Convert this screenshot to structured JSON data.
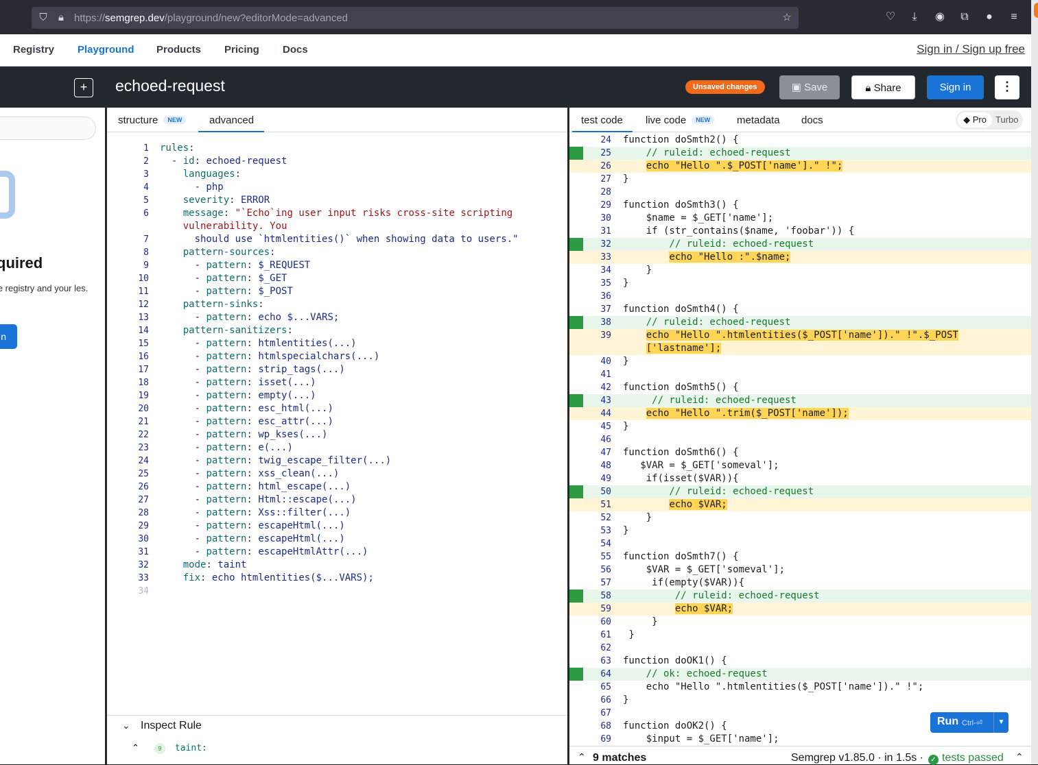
{
  "browser": {
    "url_prefix": "https://",
    "url_host": "semgrep.dev",
    "url_path": "/playground/new?editorMode=advanced"
  },
  "nav": {
    "links": [
      "Registry",
      "Playground",
      "Products",
      "Pricing",
      "Docs"
    ],
    "active": "Playground",
    "signup": "Sign in / Sign up free"
  },
  "sidebar": {
    "title_partial": "quired",
    "desc_partial": "the registry and your les.",
    "button_partial": "n"
  },
  "header": {
    "rule_name": "echoed-request",
    "unsaved_badge": "Unsaved changes",
    "save": "Save",
    "share": "Share",
    "signin": "Sign in",
    "more": "⋮"
  },
  "left_tabs": {
    "structure": "structure",
    "structure_badge": "NEW",
    "advanced": "advanced"
  },
  "right_tabs": {
    "test_code": "test code",
    "live_code": "live code",
    "live_badge": "NEW",
    "metadata": "metadata",
    "docs": "docs",
    "pro": "Pro",
    "turbo": "Turbo"
  },
  "inspect": {
    "title": "Inspect Rule",
    "badge": "9",
    "item": "taint:"
  },
  "run": {
    "label": "Run",
    "shortcut": "Ctrl-⏎"
  },
  "status": {
    "matches": "9 matches",
    "version": "Semgrep v1.85.0 · in 1.5s ·",
    "tests": "tests passed"
  },
  "yaml_lines": [
    {
      "n": "1",
      "t": "rules:"
    },
    {
      "n": "2",
      "t": "  - id: echoed-request"
    },
    {
      "n": "3",
      "t": "    languages:"
    },
    {
      "n": "4",
      "t": "      - php"
    },
    {
      "n": "5",
      "t": "    severity: ERROR"
    },
    {
      "n": "6",
      "t": "    message: \"`Echo`ing user input risks cross-site scripting"
    },
    {
      "n": "",
      "t": "    vulnerability. You"
    },
    {
      "n": "7",
      "t": "      should use `htmlentities()` when showing data to users.\""
    },
    {
      "n": "8",
      "t": "    pattern-sources:"
    },
    {
      "n": "9",
      "t": "      - pattern: $_REQUEST"
    },
    {
      "n": "10",
      "t": "      - pattern: $_GET"
    },
    {
      "n": "11",
      "t": "      - pattern: $_POST"
    },
    {
      "n": "12",
      "t": "    pattern-sinks:"
    },
    {
      "n": "13",
      "t": "      - pattern: echo $...VARS;"
    },
    {
      "n": "14",
      "t": "    pattern-sanitizers:"
    },
    {
      "n": "15",
      "t": "      - pattern: htmlentities(...)"
    },
    {
      "n": "16",
      "t": "      - pattern: htmlspecialchars(...)"
    },
    {
      "n": "17",
      "t": "      - pattern: strip_tags(...)"
    },
    {
      "n": "18",
      "t": "      - pattern: isset(...)"
    },
    {
      "n": "19",
      "t": "      - pattern: empty(...)"
    },
    {
      "n": "20",
      "t": "      - pattern: esc_html(...)"
    },
    {
      "n": "21",
      "t": "      - pattern: esc_attr(...)"
    },
    {
      "n": "22",
      "t": "      - pattern: wp_kses(...)"
    },
    {
      "n": "23",
      "t": "      - pattern: e(...)"
    },
    {
      "n": "24",
      "t": "      - pattern: twig_escape_filter(...)"
    },
    {
      "n": "25",
      "t": "      - pattern: xss_clean(...)"
    },
    {
      "n": "26",
      "t": "      - pattern: html_escape(...)"
    },
    {
      "n": "27",
      "t": "      - pattern: Html::escape(...)"
    },
    {
      "n": "28",
      "t": "      - pattern: Xss::filter(...)"
    },
    {
      "n": "29",
      "t": "      - pattern: escapeHtml(...)"
    },
    {
      "n": "30",
      "t": "      - pattern: escapeHtml(...)"
    },
    {
      "n": "31",
      "t": "      - pattern: escapeHtmlAttr(...)"
    },
    {
      "n": "32",
      "t": "    mode: taint"
    },
    {
      "n": "33",
      "t": "    fix: echo htmlentities($...VARS);"
    },
    {
      "n": "34",
      "t": ""
    }
  ],
  "code_lines": [
    {
      "n": "24",
      "t": "function doSmth2() {",
      "k": ""
    },
    {
      "n": "25",
      "t": "    // ruleid: echoed-request",
      "k": "cm"
    },
    {
      "n": "26",
      "t": "    echo \"Hello \".$_POST['name'].\" !\";",
      "k": "hl"
    },
    {
      "n": "27",
      "t": "}",
      "k": ""
    },
    {
      "n": "28",
      "t": "",
      "k": ""
    },
    {
      "n": "29",
      "t": "function doSmth3() {",
      "k": ""
    },
    {
      "n": "30",
      "t": "    $name = $_GET['name'];",
      "k": ""
    },
    {
      "n": "31",
      "t": "    if (str_contains($name, 'foobar')) {",
      "k": ""
    },
    {
      "n": "32",
      "t": "        // ruleid: echoed-request",
      "k": "cm"
    },
    {
      "n": "33",
      "t": "        echo \"Hello :\".$name;",
      "k": "hl"
    },
    {
      "n": "34",
      "t": "    }",
      "k": ""
    },
    {
      "n": "35",
      "t": "}",
      "k": ""
    },
    {
      "n": "36",
      "t": "",
      "k": ""
    },
    {
      "n": "37",
      "t": "function doSmth4() {",
      "k": ""
    },
    {
      "n": "38",
      "t": "    // ruleid: echoed-request",
      "k": "cm"
    },
    {
      "n": "39",
      "t": "    echo \"Hello \".htmlentities($_POST['name']).\" !\".$_POST",
      "k": "hl"
    },
    {
      "n": "",
      "t": "    ['lastname'];",
      "k": "hl"
    },
    {
      "n": "40",
      "t": "}",
      "k": ""
    },
    {
      "n": "41",
      "t": "",
      "k": ""
    },
    {
      "n": "42",
      "t": "function doSmth5() {",
      "k": ""
    },
    {
      "n": "43",
      "t": "     // ruleid: echoed-request",
      "k": "cm"
    },
    {
      "n": "44",
      "t": "    echo \"Hello \".trim($_POST['name']);",
      "k": "hl"
    },
    {
      "n": "45",
      "t": "}",
      "k": ""
    },
    {
      "n": "46",
      "t": "",
      "k": ""
    },
    {
      "n": "47",
      "t": "function doSmth6() {",
      "k": ""
    },
    {
      "n": "48",
      "t": "   $VAR = $_GET['someval'];",
      "k": ""
    },
    {
      "n": "49",
      "t": "    if(isset($VAR)){",
      "k": ""
    },
    {
      "n": "50",
      "t": "        // ruleid: echoed-request",
      "k": "cm"
    },
    {
      "n": "51",
      "t": "        echo $VAR;",
      "k": "hl"
    },
    {
      "n": "52",
      "t": "    }",
      "k": ""
    },
    {
      "n": "53",
      "t": "}",
      "k": ""
    },
    {
      "n": "54",
      "t": "",
      "k": ""
    },
    {
      "n": "55",
      "t": "function doSmth7() {",
      "k": ""
    },
    {
      "n": "56",
      "t": "    $VAR = $_GET['someval'];",
      "k": ""
    },
    {
      "n": "57",
      "t": "     if(empty($VAR)){",
      "k": ""
    },
    {
      "n": "58",
      "t": "         // ruleid: echoed-request",
      "k": "cm"
    },
    {
      "n": "59",
      "t": "         echo $VAR;",
      "k": "hl"
    },
    {
      "n": "60",
      "t": "     }",
      "k": ""
    },
    {
      "n": "61",
      "t": " }",
      "k": ""
    },
    {
      "n": "62",
      "t": "",
      "k": ""
    },
    {
      "n": "63",
      "t": "function doOK1() {",
      "k": ""
    },
    {
      "n": "64",
      "t": "    // ok: echoed-request",
      "k": "cm"
    },
    {
      "n": "65",
      "t": "    echo \"Hello \".htmlentities($_POST['name']).\" !\";",
      "k": ""
    },
    {
      "n": "66",
      "t": "}",
      "k": ""
    },
    {
      "n": "67",
      "t": "",
      "k": ""
    },
    {
      "n": "68",
      "t": "function doOK2() {",
      "k": ""
    },
    {
      "n": "69",
      "t": "    $input = $_GET['name'];",
      "k": ""
    }
  ],
  "colors": {
    "accent": "#1a73d6",
    "unsaved": "#ef6a1b",
    "match_marker": "#2d9b42",
    "highlight": "#ffd557"
  }
}
